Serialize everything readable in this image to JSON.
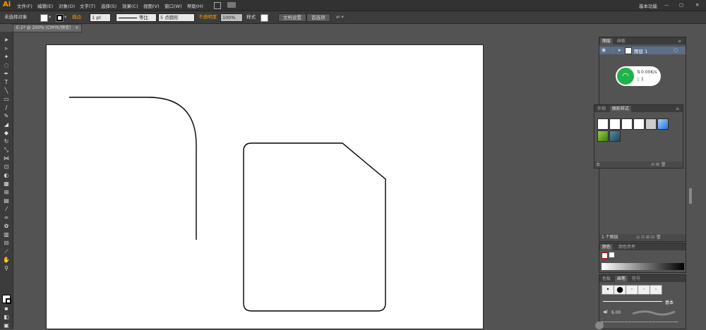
{
  "app": {
    "logo": "Ai",
    "workspace": "基本功能"
  },
  "menu": {
    "items": [
      "文件(F)",
      "编辑(E)",
      "对象(O)",
      "文字(T)",
      "选择(S)",
      "效果(C)",
      "视图(V)",
      "窗口(W)",
      "帮助(H)"
    ]
  },
  "control": {
    "selection_label": "未选择对象",
    "stroke_label": "描边",
    "stroke_weight": "1 pt",
    "stroke_profile": "等比",
    "brush_def": "5 点圆形",
    "opacity_label": "不透明度",
    "opacity_value": "100%",
    "style_label": "样式",
    "doc_setup_label": "文档设置",
    "prefs_label": "首选项"
  },
  "tab": {
    "title": "E-1* @ 200% (CMYK/预览)",
    "close": "×"
  },
  "layers_panel": {
    "tabs": [
      "图层",
      "画板"
    ],
    "layer_name": "图层 1",
    "footer": "1 个图层"
  },
  "network_widget": {
    "speed": "0.00K/s",
    "count": "1"
  },
  "graphic_styles_panel": {
    "tabs": [
      "外观",
      "图形样式"
    ]
  },
  "color_panel": {
    "tabs": [
      "颜色",
      "颜色参考"
    ]
  },
  "brushes_panel": {
    "tabs": [
      "色板",
      "画笔",
      "符号"
    ],
    "basic_label": "基本",
    "size_value": "6.00"
  },
  "colors": {
    "accent": "#ff9a00",
    "ui_dark": "#323232",
    "ui_mid": "#3c3c3c",
    "ui_bg": "#535353",
    "wifi_green": "#21b24b"
  }
}
